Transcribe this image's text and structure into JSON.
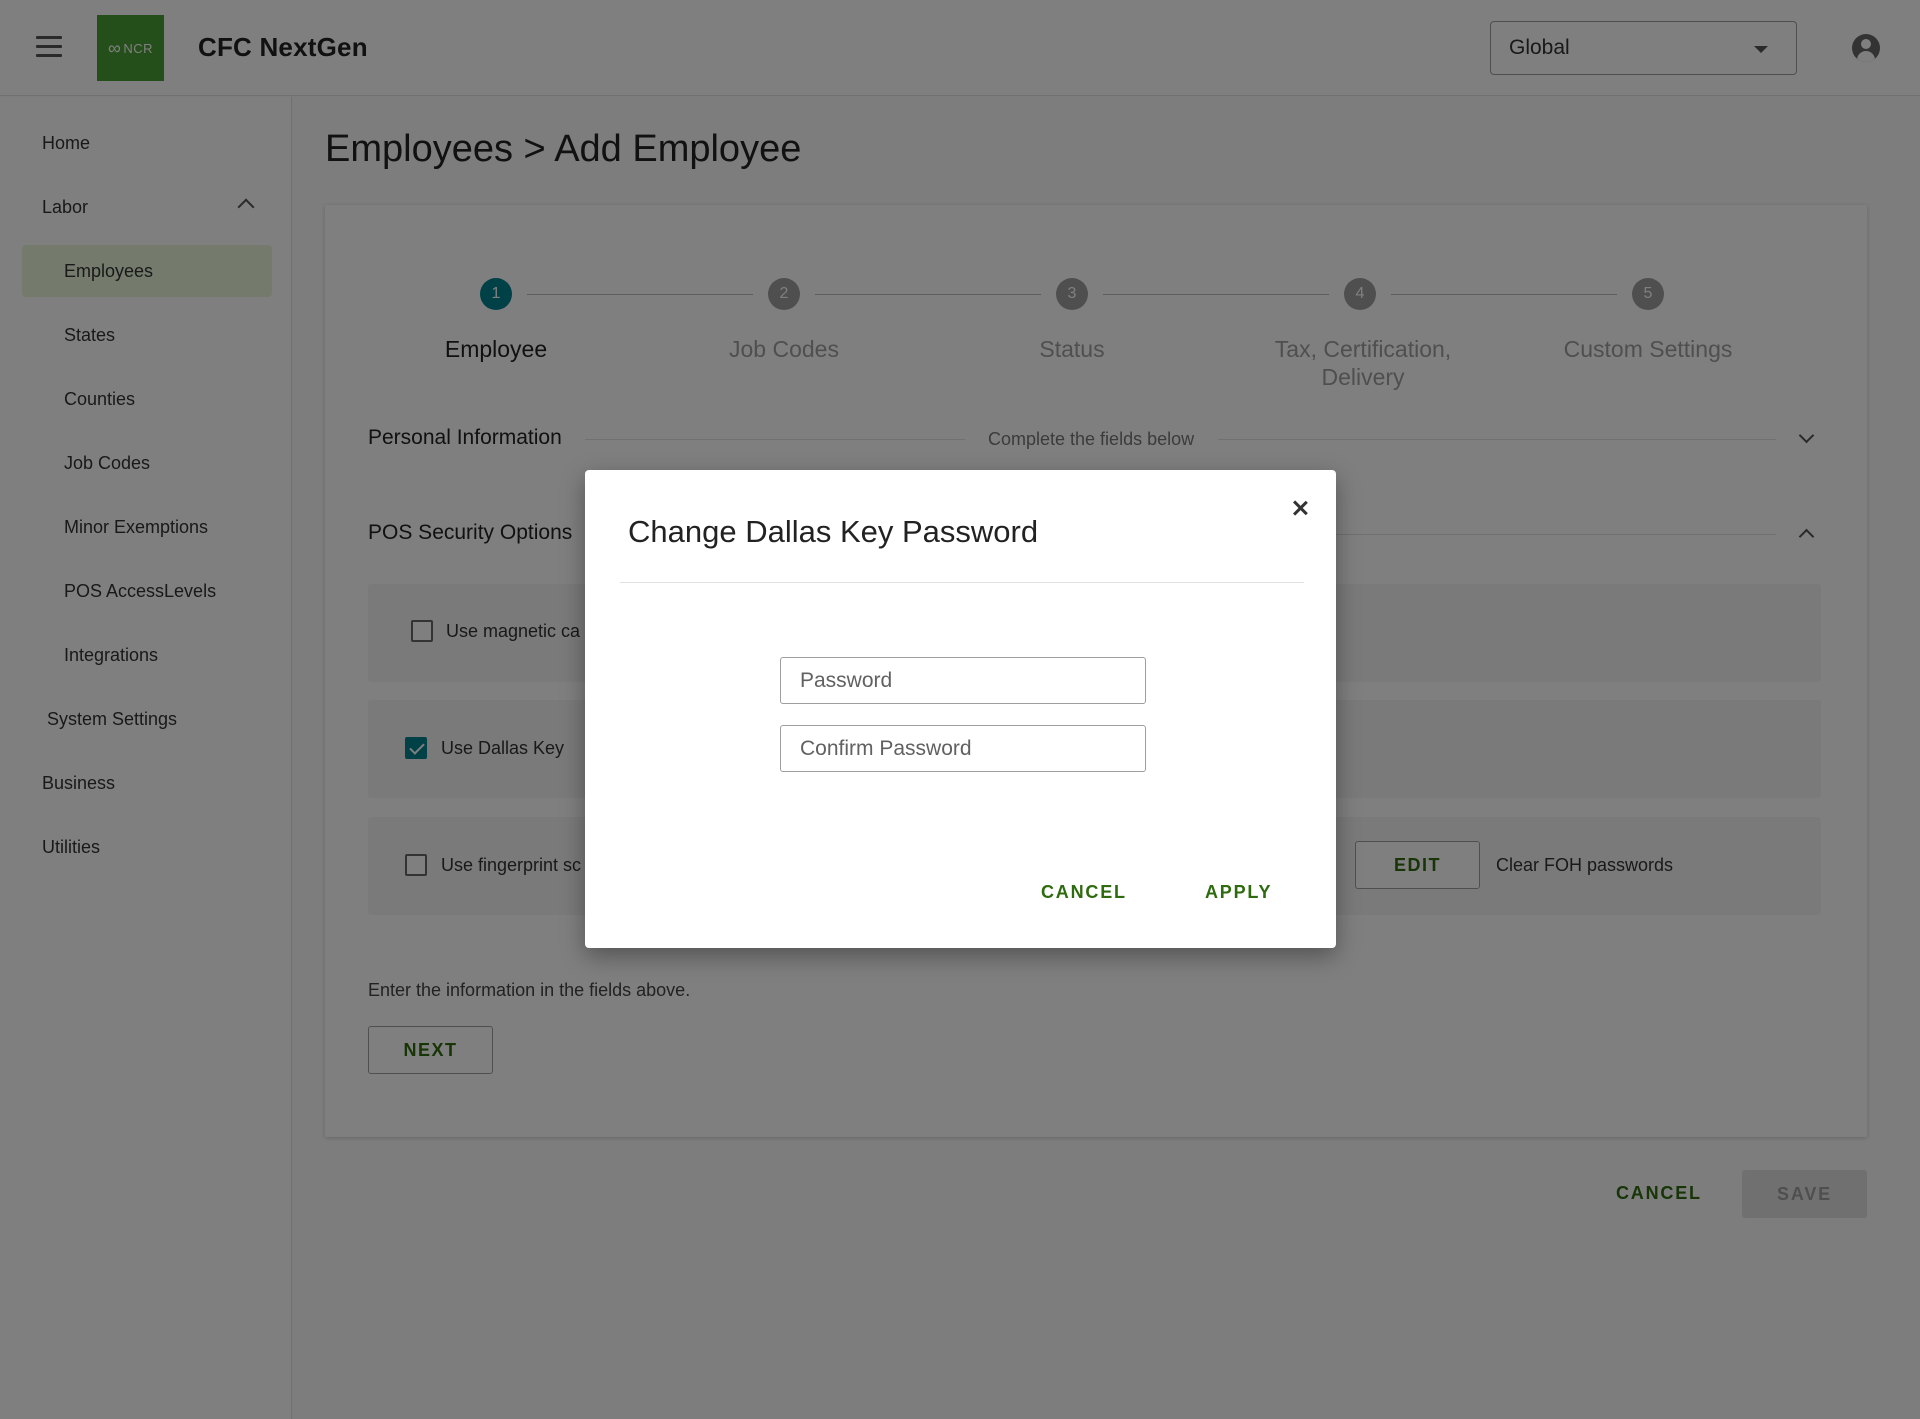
{
  "header": {
    "app_title": "CFC NextGen",
    "logo_text": "NCR",
    "scope_value": "Global",
    "brand_color": "#4a9e35"
  },
  "sidebar": {
    "items": [
      {
        "label": "Home"
      },
      {
        "label": "Labor",
        "expanded": true
      },
      {
        "label": "Employees",
        "active": true
      },
      {
        "label": "States"
      },
      {
        "label": "Counties"
      },
      {
        "label": "Job Codes"
      },
      {
        "label": "Minor Exemptions"
      },
      {
        "label": "POS AccessLevels"
      },
      {
        "label": "Integrations"
      },
      {
        "label": "System Settings"
      },
      {
        "label": "Business"
      },
      {
        "label": "Utilities"
      }
    ]
  },
  "main": {
    "page_title": "Employees > Add Employee",
    "steps": [
      {
        "num": "1",
        "label": "Employee",
        "active": true
      },
      {
        "num": "2",
        "label": "Job Codes"
      },
      {
        "num": "3",
        "label": "Status"
      },
      {
        "num": "4",
        "label": "Tax, Certification, Delivery"
      },
      {
        "num": "5",
        "label": "Custom Settings"
      }
    ],
    "sections": {
      "personal": {
        "title": "Personal Information",
        "subtitle": "Complete the fields below"
      },
      "pos_security": {
        "title": "POS Security Options"
      }
    },
    "options": {
      "magnetic": {
        "label": "Use magnetic ca",
        "checked": false
      },
      "dallas": {
        "label": "Use Dallas Key",
        "checked": true
      },
      "fingerprint": {
        "label": "Use fingerprint sc",
        "checked": false
      },
      "edit_label": "EDIT",
      "clear_foh": "Clear FOH passwords"
    },
    "hint": "Enter the information in the fields above.",
    "next_label": "NEXT",
    "cancel_label": "CANCEL",
    "save_label": "SAVE"
  },
  "modal": {
    "title": "Change Dallas Key Password",
    "password_placeholder": "Password",
    "confirm_placeholder": "Confirm Password",
    "cancel_label": "CANCEL",
    "apply_label": "APPLY"
  },
  "colors": {
    "accent_teal": "#00838f",
    "action_green": "#2e6b0f",
    "active_nav_bg": "#e8f5d9"
  }
}
